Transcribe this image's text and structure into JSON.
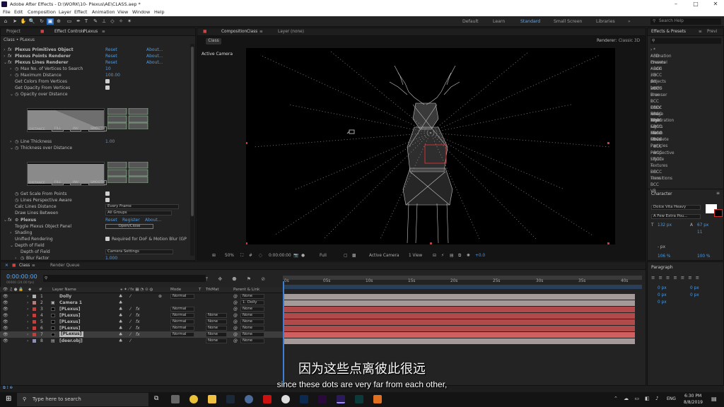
{
  "titlebar": {
    "title": "Adobe After Effects - D:\\WORK\\10- Plexus\\AE\\CLASS.aep *",
    "minimize": "–",
    "maximize": "□",
    "close": "✕"
  },
  "menu": [
    "File",
    "Edit",
    "Composition",
    "Layer",
    "Effect",
    "Animation",
    "View",
    "Window",
    "Help"
  ],
  "workspaces": {
    "items": [
      "Default",
      "Learn",
      "Standard",
      "Small Screen",
      "Libraries"
    ],
    "active": "Standard",
    "search": "Search Help"
  },
  "left_panel": {
    "tab_project": "Project",
    "tab_effect": "Effect Controls",
    "tab_effect_target": "PLexus",
    "path": "Class • PLexus",
    "rows": [
      {
        "indent": 0,
        "label": "Plexus Primitives Object",
        "reset": "Reset",
        "about": "About..."
      },
      {
        "indent": 0,
        "label": "Plexus Points Renderer",
        "reset": "Reset",
        "about": "About..."
      },
      {
        "indent": 0,
        "label": "Plexus Lines Renderer",
        "reset": "Reset",
        "about": "About..."
      },
      {
        "indent": 1,
        "label": "Max No. of Vertices to Search",
        "value": "10"
      },
      {
        "indent": 1,
        "label": "Maximum Distance",
        "value": "100.00"
      },
      {
        "indent": 1,
        "label": "Get Colors From Vertices",
        "check": true
      },
      {
        "indent": 1,
        "label": "Get Opacity From Vertices",
        "check": true
      },
      {
        "indent": 1,
        "label": "Opacity over Distance"
      }
    ],
    "graph_labels": {
      "distance": "DISTANCE",
      "fill": "FILL",
      "inv": "INV",
      "smooth": "SMOOTH",
      "opacity": "OPACITY"
    },
    "line_thickness": {
      "label": "Line Thickness",
      "value": "1.00"
    },
    "thickness_over_distance": "Thickness over Distance",
    "rows2": [
      {
        "label": "Get Scale From Points",
        "check": true
      },
      {
        "label": "Lines Perspective Aware",
        "check": true
      },
      {
        "label": "Calc Lines Distance",
        "dropdown": "Every Frame"
      },
      {
        "label": "Draw Lines Between",
        "dropdown": "All Groups"
      }
    ],
    "plexus": {
      "label": "Plexus",
      "reset": "Reset",
      "register": "Register",
      "about": "About..."
    },
    "toggle_panel": {
      "label": "Toggle Plexus Object Panel",
      "button": "Open/Close"
    },
    "shading": "Shading",
    "unified": {
      "label": "Unified Rendering",
      "check_label": "Required for DoF & Motion Blur (GP"
    },
    "dof": {
      "label": "Depth of Field",
      "sub": "Depth of Field",
      "dropdown": "Camera Settings"
    },
    "blur": {
      "label": "Blur Factor",
      "value": "1.000"
    }
  },
  "composition": {
    "tab": "Composition",
    "tab_target": "Class",
    "layer_tab": "Layer (none)",
    "comp_chip": "Class",
    "renderer_label": "Renderer:",
    "renderer": "Classic 3D",
    "view_label": "Active Camera",
    "controls": {
      "zoom": "50%",
      "timecode": "0:00:00:00",
      "quality": "Full",
      "camera": "Active Camera",
      "views": "1 View",
      "exposure": "+0.0"
    }
  },
  "right_panel": {
    "tab_effects": "Effects & Presets",
    "tab_prev": "Previ",
    "effects": [
      "* Animation Presets",
      "3D Channel",
      "Audio",
      "BCC 3D Objects",
      "BCC Art Looks",
      "BCC Blur",
      "BCC Browser",
      "BCC Color & Tone",
      "BCC Film Style",
      "BCC Image Restoration",
      "BCC Key & Blend",
      "BCC Lights",
      "BCC Match Move",
      "BCC Obsolete",
      "BCC Particles",
      "BCC Perspective",
      "BCC Stylize",
      "BCC Textures",
      "BCC Time",
      "BCC Transitions",
      "BCC VR"
    ],
    "character": {
      "title": "Character",
      "font": "Dolce Vita Heavy",
      "style": "A Few Extra Pou...",
      "size": "132 px",
      "leading": "67 px",
      "tracking": "11",
      "unit": "- px",
      "scale_v": "106 %",
      "scale_h": "100 %"
    },
    "paragraph": {
      "title": "Paragraph",
      "values": [
        "0 px",
        "0 px",
        "0 px",
        "0 px",
        "0 px"
      ]
    }
  },
  "timeline": {
    "tab": "Class",
    "render_queue": "Render Queue",
    "timecode": "0:00:00:00",
    "fps": "00000 (24.00 fps)",
    "columns": {
      "name": "Layer Name",
      "mode": "Mode",
      "t": "T",
      "trkmat": "TrkMat",
      "parent": "Parent & Link"
    },
    "ruler": [
      "0s",
      "05s",
      "10s",
      "15s",
      "20s",
      "25s",
      "30s",
      "35s",
      "40s"
    ],
    "layers": [
      {
        "num": "1",
        "name": "Dolly",
        "color": "#b0b0b0",
        "mode": "Normal",
        "trkmat": "",
        "parent": "None",
        "kind": "null"
      },
      {
        "num": "2",
        "name": "Camera 1",
        "color": "#b08080",
        "mode": "",
        "trkmat": "",
        "parent": "1. Dolly",
        "kind": "cam"
      },
      {
        "num": "3",
        "name": "[PLexus]",
        "color": "#c04040",
        "mode": "Normal",
        "trkmat": "",
        "parent": "None",
        "kind": "solid"
      },
      {
        "num": "4",
        "name": "[PLexus]",
        "color": "#c04040",
        "mode": "Normal",
        "trkmat": "None",
        "parent": "None",
        "kind": "solid"
      },
      {
        "num": "5",
        "name": "[PLexus]",
        "color": "#c04040",
        "mode": "Normal",
        "trkmat": "None",
        "parent": "None",
        "kind": "solid"
      },
      {
        "num": "6",
        "name": "[PLexus]",
        "color": "#c04040",
        "mode": "Normal",
        "trkmat": "None",
        "parent": "None",
        "kind": "solid"
      },
      {
        "num": "7",
        "name": "[PLexus]",
        "color": "#c04040",
        "mode": "Normal",
        "trkmat": "None",
        "parent": "None",
        "kind": "solid"
      },
      {
        "num": "8",
        "name": "[deer.obj]",
        "color": "#9090b0",
        "mode": "",
        "trkmat": "None",
        "parent": "None",
        "kind": "obj"
      }
    ],
    "switch_label": "Toggle Switches / Modes"
  },
  "subtitles": {
    "zh": "因为这些点离彼此很远",
    "en": "since these dots are very far from each other,"
  },
  "taskbar": {
    "search": "Type here to search",
    "time": "6:30 PM",
    "date": "8/8/2019",
    "lang": "ENG"
  }
}
